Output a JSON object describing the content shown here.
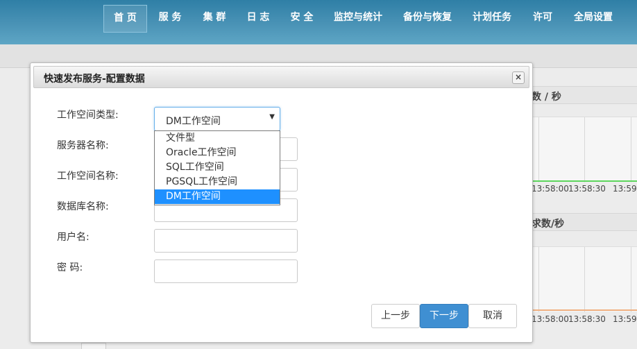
{
  "nav": {
    "items": [
      {
        "label": "首 页",
        "active": true
      },
      {
        "label": "服 务"
      },
      {
        "label": "集 群"
      },
      {
        "label": "日 志"
      },
      {
        "label": "安 全"
      },
      {
        "label": "监控与统计"
      },
      {
        "label": "备份与恢复"
      },
      {
        "label": "计划任务"
      },
      {
        "label": "许可"
      },
      {
        "label": "全局设置"
      }
    ]
  },
  "background": {
    "panel1_title": "数 / 秒",
    "panel2_title": "求数/秒",
    "ticks_row1": [
      "13:58:00",
      "13:58:30",
      "13:59:"
    ],
    "ticks_row2": [
      "13:58:00",
      "13:58:30",
      "13:59:"
    ],
    "line1_color": "#5cd65c",
    "line2_color": "#f0b080"
  },
  "modal": {
    "title": "快速发布服务-配置数据",
    "close_symbol": "×",
    "labels": {
      "workspace_type": "工作空间类型:",
      "server_name": "服务器名称:",
      "workspace_name": "工作空间名称:",
      "database_name": "数据库名称:",
      "username": "用户名:",
      "password": "密 码:"
    },
    "select": {
      "value": "DM工作空间",
      "arrow": "▼",
      "options": [
        "文件型",
        "Oracle工作空间",
        "SQL工作空间",
        "PGSQL工作空间",
        "DM工作空间"
      ],
      "selected_index": 4
    },
    "buttons": {
      "prev": "上一步",
      "next": "下一步",
      "cancel": "取消"
    }
  }
}
